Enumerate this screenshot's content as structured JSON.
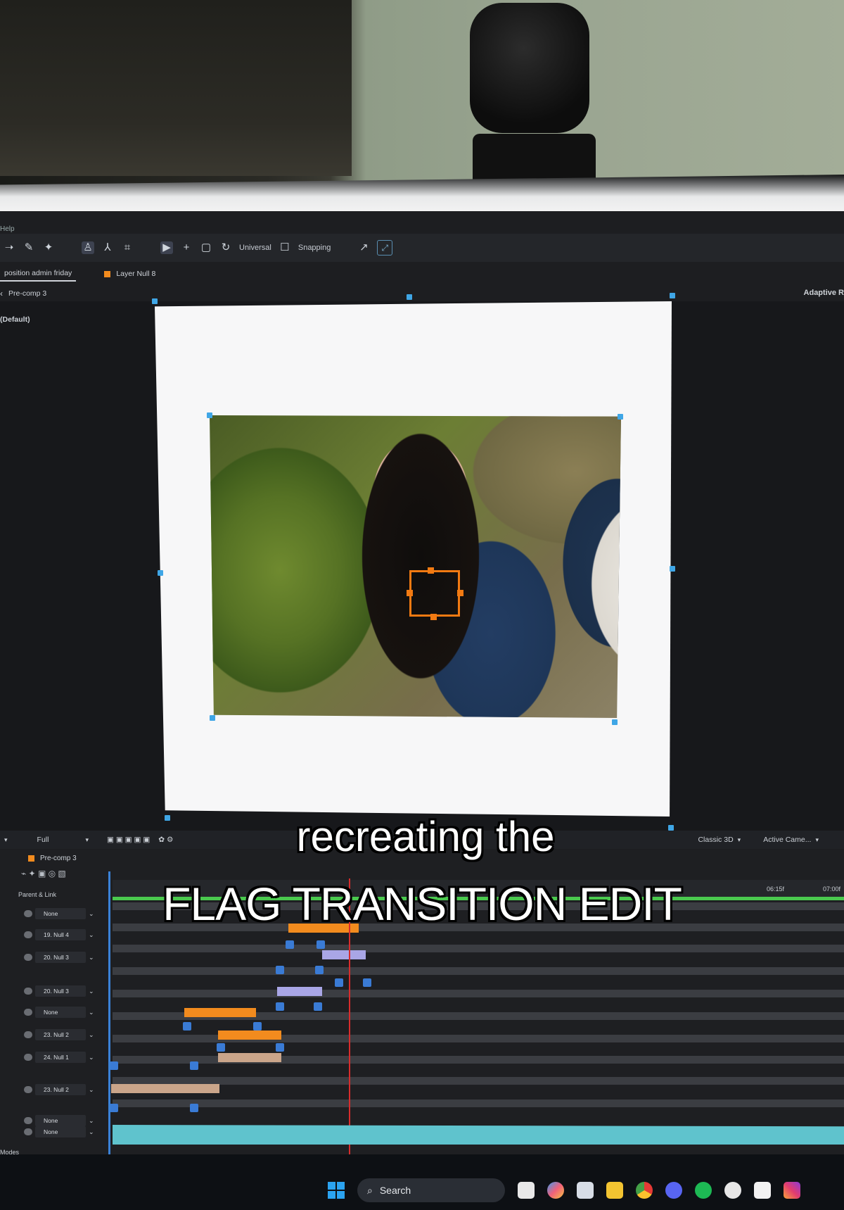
{
  "menu": {
    "help": "Help"
  },
  "toolbar": {
    "universal_label": "Universal",
    "snapping_label": "Snapping"
  },
  "tabs": {
    "composition": "position admin friday",
    "layer": "Layer Null 8"
  },
  "breadcrumb": {
    "item": "Pre-comp 3"
  },
  "viewer": {
    "adaptive_label": "Adaptive R",
    "default_label": "(Default)"
  },
  "view_controls": {
    "resolution": "Full",
    "renderer": "Classic 3D",
    "camera": "Active Came..."
  },
  "caption": {
    "line1": "recreating the",
    "line2": "FLAG TRANSITION EDIT"
  },
  "timeline": {
    "comp_tab": "Pre-comp 3",
    "column_header": "Parent & Link",
    "ruler": [
      "06:15f",
      "07:00f"
    ],
    "layers": [
      {
        "parent": "None"
      },
      {
        "parent": "19. Null 4"
      },
      {
        "parent": "20. Null 3"
      },
      {
        "parent": "20. Null 3"
      },
      {
        "parent": "None"
      },
      {
        "parent": "23. Null 2"
      },
      {
        "parent": "24. Null 1"
      },
      {
        "parent": "23. Null 2"
      },
      {
        "parent": "None"
      },
      {
        "parent": "None"
      }
    ],
    "bottom_label": "Modes"
  },
  "taskbar": {
    "search_label": "Search"
  },
  "colors": {
    "accent_orange": "#f28b1e",
    "keyframe_blue": "#3a7bd5",
    "playhead_red": "#d82c2c",
    "workarea_green": "#4ac94e",
    "lavender_bar": "#a9a6e6",
    "tan_bar": "#caa58a"
  }
}
